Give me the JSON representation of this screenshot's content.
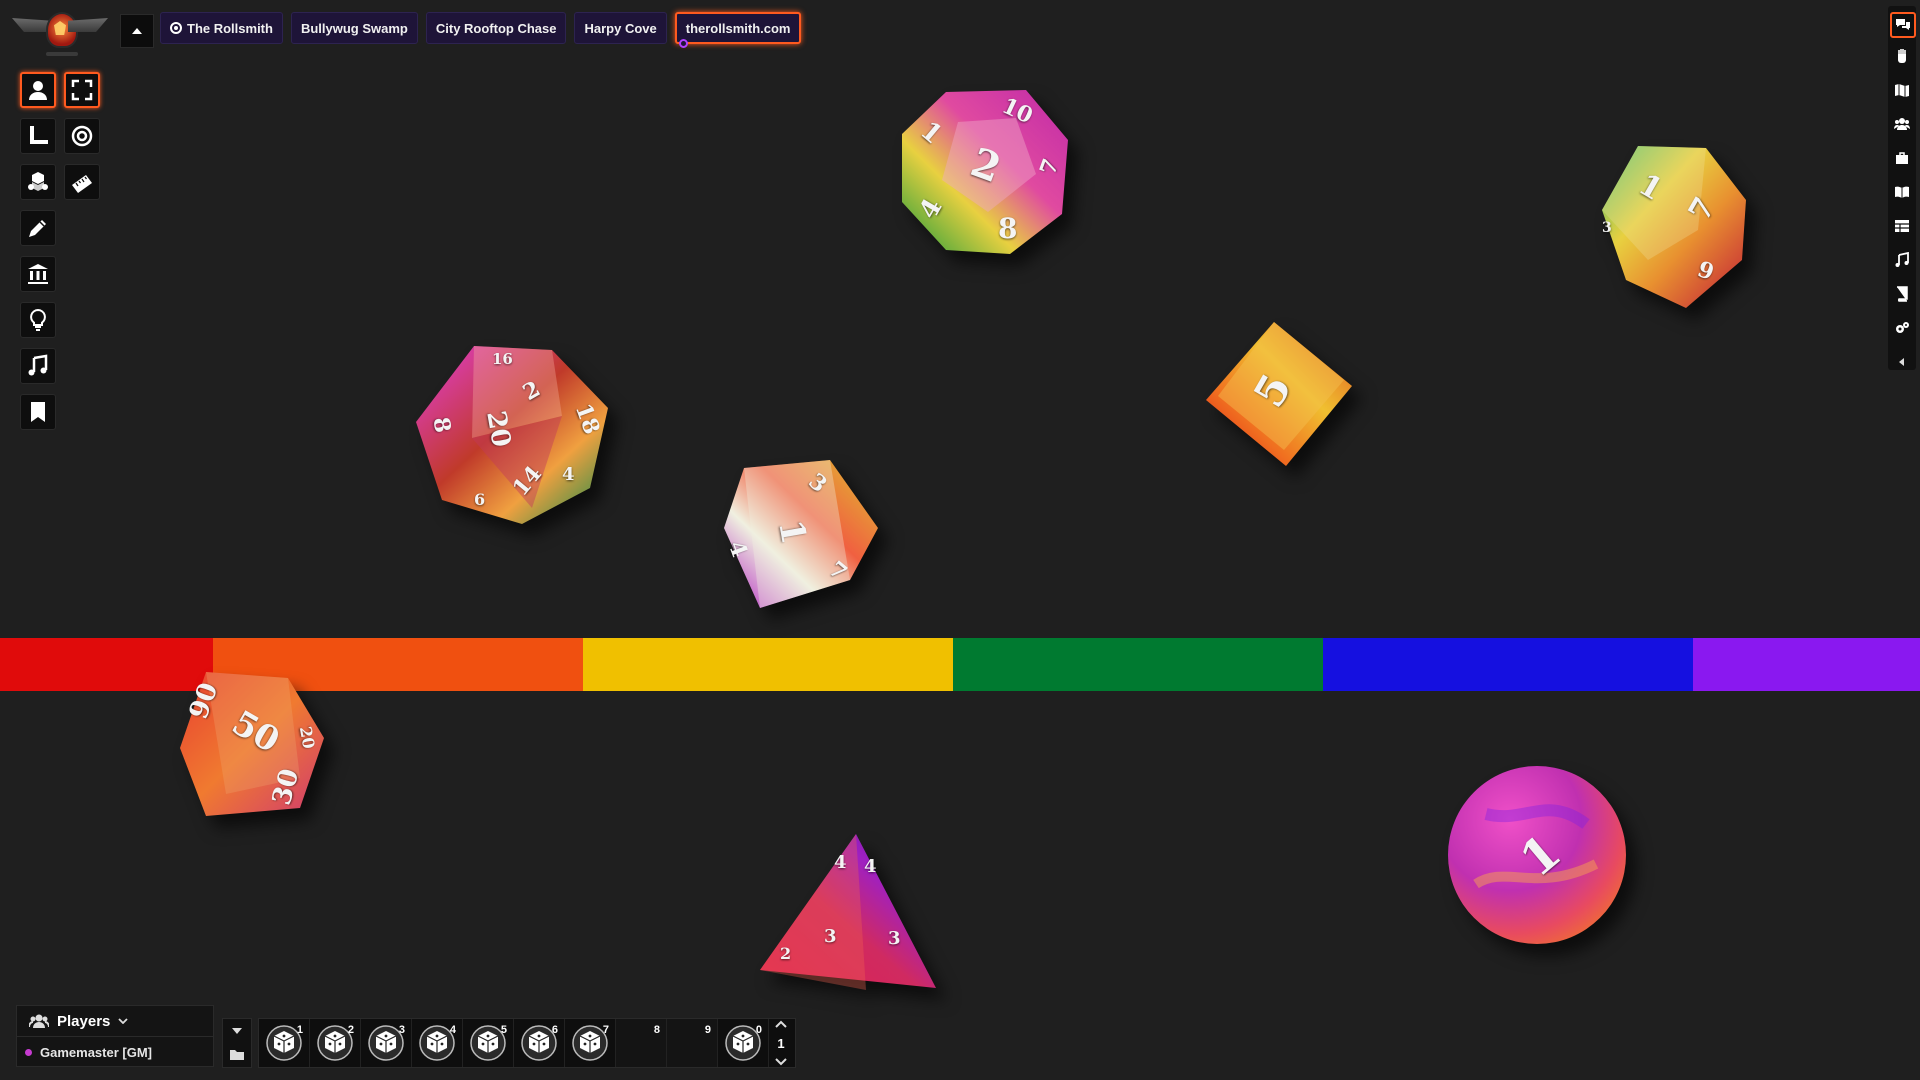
{
  "app": {
    "icons": {
      "logo": "rollsmith-logo",
      "collapse": "caret-up-icon"
    }
  },
  "tabs": [
    {
      "label": "The Rollsmith",
      "icon": "target-icon",
      "active": false
    },
    {
      "label": "Bullywug Swamp",
      "active": false
    },
    {
      "label": "City Rooftop Chase",
      "active": false
    },
    {
      "label": "Harpy Cove",
      "active": false
    },
    {
      "label": "therollsmith.com",
      "active": true
    }
  ],
  "left_tools": [
    {
      "name": "select-tool",
      "icon": "person-icon",
      "active": true
    },
    {
      "name": "fullscreen-tool",
      "icon": "expand-icon",
      "active": true
    },
    {
      "name": "measure-tool",
      "icon": "ruler-corner-icon"
    },
    {
      "name": "target-tool",
      "icon": "target-icon"
    },
    {
      "name": "dice-tool",
      "icon": "dice-icon"
    },
    {
      "name": "ruler-tool",
      "icon": "ruler-icon"
    },
    {
      "name": "draw-tool",
      "icon": "pencil-icon"
    },
    {
      "name": "library-tool",
      "icon": "bank-icon"
    },
    {
      "name": "light-tool",
      "icon": "lightbulb-icon"
    },
    {
      "name": "music-tool",
      "icon": "music-icon"
    },
    {
      "name": "bookmark-tool",
      "icon": "bookmark-icon"
    }
  ],
  "right_sidebar": [
    {
      "name": "chat-tab",
      "icon": "chat-icon",
      "active": true
    },
    {
      "name": "art-tab",
      "icon": "hand-icon"
    },
    {
      "name": "map-tab",
      "icon": "map-icon"
    },
    {
      "name": "characters-tab",
      "icon": "users-icon"
    },
    {
      "name": "inventory-tab",
      "icon": "briefcase-icon"
    },
    {
      "name": "compendium-tab",
      "icon": "book-open-icon"
    },
    {
      "name": "tables-tab",
      "icon": "table-icon"
    },
    {
      "name": "jukebox-tab",
      "icon": "music-icon"
    },
    {
      "name": "journal-tab",
      "icon": "book-icon"
    },
    {
      "name": "settings-tab",
      "icon": "gears-icon"
    },
    {
      "name": "collapse-tab",
      "icon": "caret-left-icon"
    }
  ],
  "rainbow_colors": [
    "#e00b0b",
    "#f05010",
    "#f0c000",
    "#007a30",
    "#1510e0",
    "#8a18f0"
  ],
  "dice": [
    {
      "name": "d20-die",
      "faces": [
        "20",
        "2",
        "8",
        "18",
        "14",
        "6",
        "4",
        "16"
      ]
    },
    {
      "name": "d12-die",
      "faces": [
        "2",
        "10",
        "1",
        "7",
        "4",
        "8"
      ]
    },
    {
      "name": "d10-die-top-right",
      "faces": [
        "1",
        "7",
        "9",
        "3"
      ]
    },
    {
      "name": "d6-die",
      "faces": [
        "5"
      ]
    },
    {
      "name": "d8-die",
      "faces": [
        "1",
        "3",
        "4",
        "7"
      ]
    },
    {
      "name": "d100-die",
      "faces": [
        "50",
        "90",
        "30",
        "20"
      ]
    },
    {
      "name": "d4-die",
      "faces": [
        "4",
        "4",
        "3",
        "3",
        "2"
      ]
    },
    {
      "name": "d2-coin-die",
      "faces": [
        "1"
      ]
    }
  ],
  "players": {
    "title": "Players",
    "entries": [
      {
        "label": "Gamemaster [GM]",
        "color": "#c63bd0"
      }
    ]
  },
  "macro_bar": {
    "slots": [
      "1",
      "2",
      "3",
      "4",
      "5",
      "6",
      "7",
      "8",
      "9",
      "0"
    ],
    "page": "1"
  }
}
